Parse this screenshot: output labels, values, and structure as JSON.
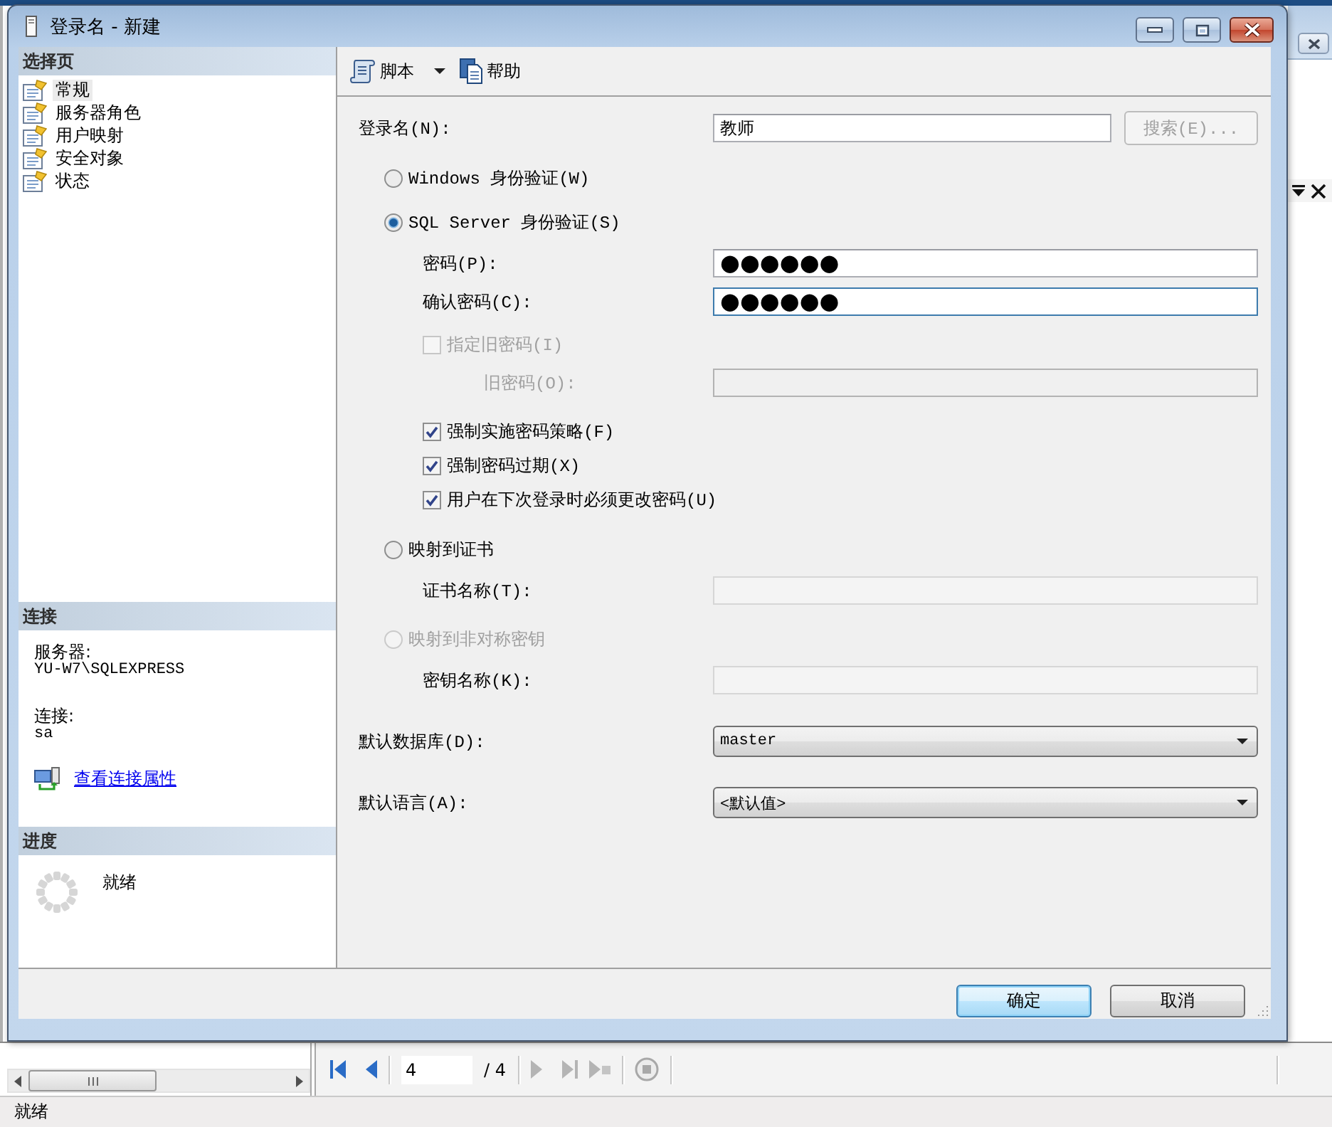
{
  "window": {
    "title": "登录名 - 新建"
  },
  "sidebar": {
    "title": "选择页",
    "items": [
      {
        "label": "常规",
        "selected": true
      },
      {
        "label": "服务器角色",
        "selected": false
      },
      {
        "label": "用户映射",
        "selected": false
      },
      {
        "label": "安全对象",
        "selected": false
      },
      {
        "label": "状态",
        "selected": false
      }
    ]
  },
  "connection": {
    "title": "连接",
    "server_label": "服务器:",
    "server": "YU-W7\\SQLEXPRESS",
    "login_label": "连接:",
    "login": "sa",
    "link": "查看连接属性"
  },
  "progress": {
    "title": "进度",
    "status": "就绪"
  },
  "toolbar": [
    {
      "kind": "dropdown",
      "label": "脚本"
    },
    {
      "kind": "button",
      "label": "帮助"
    }
  ],
  "form": {
    "login": {
      "label": "登录名(N):",
      "value": "教师",
      "button": {
        "label": "搜索(E)...",
        "disabled": true
      }
    },
    "auth": [
      {
        "kind": "radio",
        "label": "Windows 身份验证(W)",
        "selected": false,
        "disabled": false
      },
      {
        "kind": "radio",
        "label": "SQL Server 身份验证(S)",
        "selected": true,
        "disabled": false,
        "children": [
          {
            "kind": "field",
            "label": "密码(P):",
            "value": "●●●●●●",
            "focused": false,
            "disabled": false,
            "read_only": false
          },
          {
            "kind": "field",
            "label": "确认密码(C):",
            "value": "●●●●●●",
            "focused": true,
            "disabled": false,
            "read_only": false
          },
          {
            "kind": "checkbox",
            "label": "指定旧密码(I)",
            "checked": false,
            "disabled": true,
            "children": [
              {
                "kind": "field",
                "label": "旧密码(O):",
                "focused": false,
                "disabled": true,
                "read_only": false
              }
            ]
          },
          {
            "kind": "checkbox",
            "label": "强制实施密码策略(F)",
            "checked": true,
            "disabled": false
          },
          {
            "kind": "checkbox",
            "label": "强制密码过期(X)",
            "checked": true,
            "disabled": false
          },
          {
            "kind": "checkbox",
            "label": "用户在下次登录时必须更改密码(U)",
            "checked": true,
            "disabled": false
          }
        ]
      },
      {
        "kind": "radio",
        "label": "映射到证书",
        "selected": false,
        "disabled": false,
        "children": [
          {
            "kind": "field",
            "label": "证书名称(T):",
            "focused": false,
            "disabled": false,
            "read_only": true
          }
        ]
      },
      {
        "kind": "radio",
        "label": "映射到非对称密钥",
        "selected": false,
        "disabled": true,
        "children": [
          {
            "kind": "field",
            "label": "密钥名称(K):",
            "focused": false,
            "disabled": false,
            "read_only": true
          }
        ]
      }
    ],
    "defaults": [
      {
        "label": "默认数据库(D):",
        "value": "master"
      },
      {
        "label": "默认语言(A):",
        "value": "<默认值>"
      }
    ]
  },
  "buttons": [
    {
      "label": "确定",
      "default": true
    },
    {
      "label": "取消",
      "default": false
    }
  ],
  "report_toolbar": {
    "page": "4",
    "total": "/ 4"
  },
  "status_bar": {
    "text": "就绪"
  }
}
